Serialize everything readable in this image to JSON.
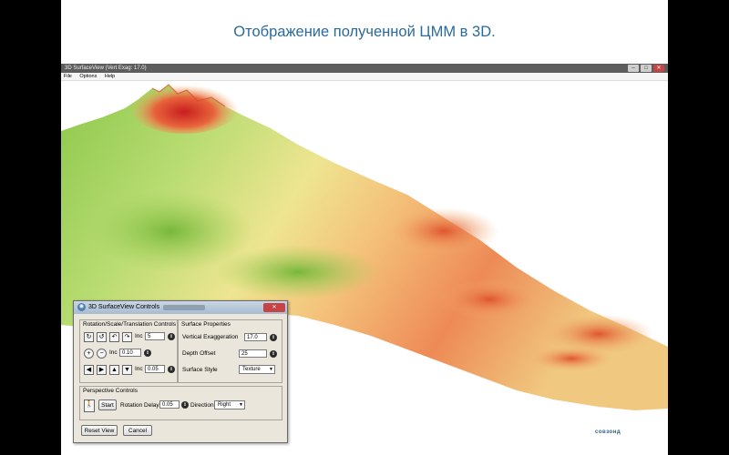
{
  "slide": {
    "title": "Отображение полученной ЦММ в 3D.",
    "brand": "совзонд"
  },
  "window": {
    "title": "3D SurfaceView (Vert Exag: 17.0)",
    "menu": [
      "File",
      "Options",
      "Help"
    ],
    "buttons": {
      "minimize": "–",
      "maximize": "□",
      "close": "✕"
    }
  },
  "dialog": {
    "title": "3D SurfaceView Controls",
    "close": "✕",
    "rotation_group": {
      "label": "Rotation/Scale/Translation Controls",
      "rot_inc_label": "Inc",
      "rot_inc_value": "5",
      "scale_inc_label": "Inc",
      "scale_inc_value": "0.10",
      "trans_inc_label": "Inc",
      "trans_inc_value": "0.05"
    },
    "surface_group": {
      "label": "Surface Properties",
      "vert_exag_label": "Vertical Exaggeration",
      "vert_exag_value": "17.0",
      "depth_offset_label": "Depth Offset",
      "depth_offset_value": "25",
      "surface_style_label": "Surface Style",
      "surface_style_value": "Texture"
    },
    "perspective_group": {
      "label": "Perspective Controls",
      "start_label": "Start",
      "rotation_delay_label": "Rotation Delay",
      "rotation_delay_value": "0.05",
      "direction_label": "Direction",
      "direction_value": "Right"
    },
    "reset_label": "Reset View",
    "cancel_label": "Cancel"
  },
  "colors": {
    "title": "#2a6a9c",
    "terrain_low": "#8cc84c",
    "terrain_mid": "#f1e58a",
    "terrain_high": "#e8643c",
    "terrain_peak": "#c81e1e"
  }
}
